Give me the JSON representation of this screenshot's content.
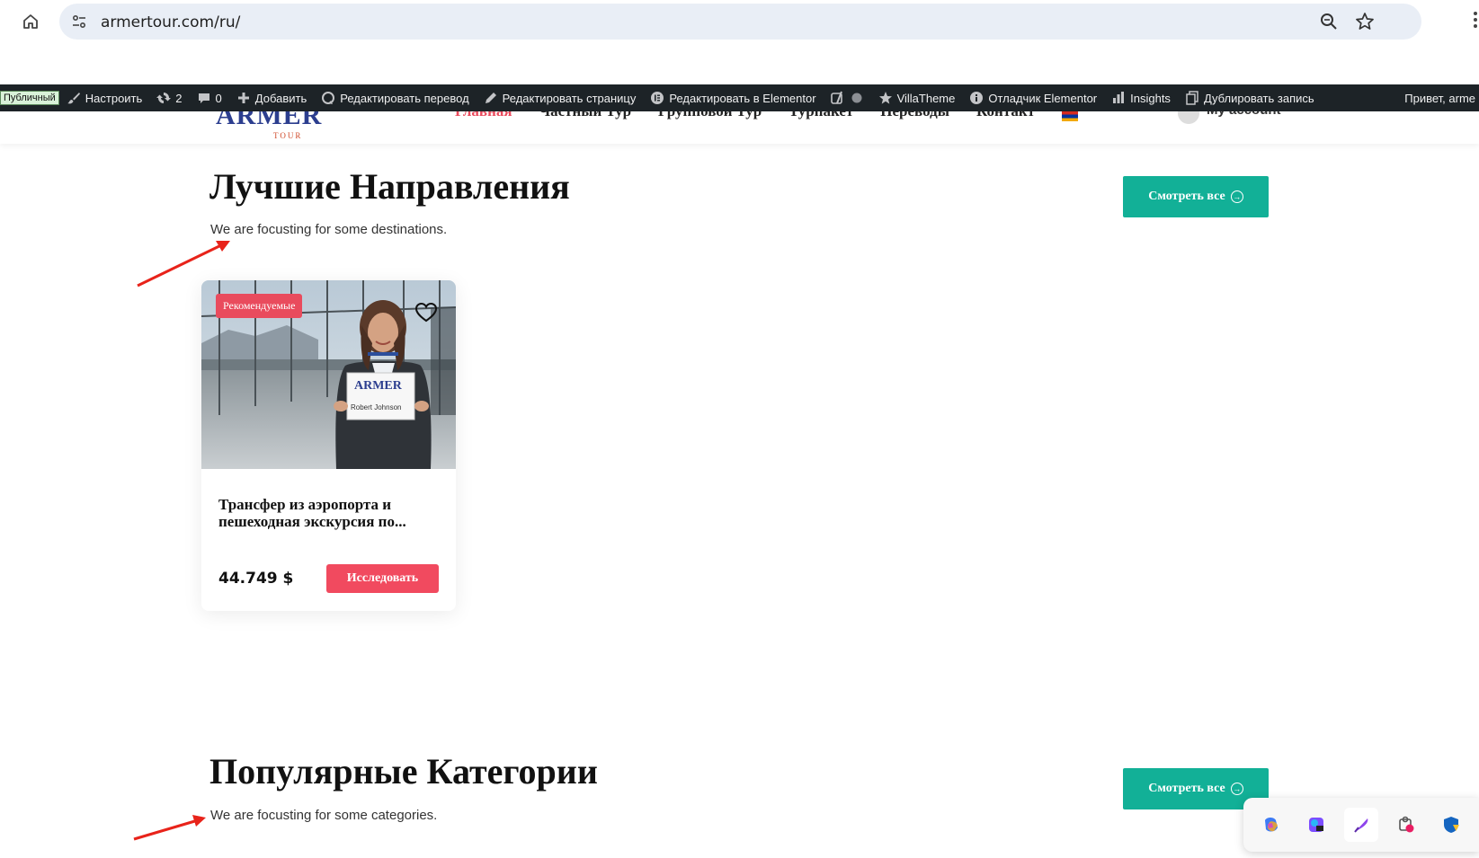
{
  "browser": {
    "url": "armertour.com/ru/"
  },
  "admin_bar": {
    "public_badge": "Публичный",
    "customize": "Настроить",
    "updates_count": "2",
    "comments_count": "0",
    "add_new": "Добавить",
    "edit_translation": "Редактировать перевод",
    "edit_page": "Редактировать страницу",
    "edit_elementor": "Редактировать в Elementor",
    "villatheme": "VillaTheme",
    "elementor_debugger": "Отладчик Elementor",
    "insights": "Insights",
    "duplicate": "Дублировать запись",
    "greeting": "Привет, arme"
  },
  "header": {
    "logo_text": "ARMER",
    "logo_sub": "TOUR",
    "nav": [
      "Главная",
      "Частный Тур",
      "Групповой Тур",
      "Турпакет",
      "Переводы",
      "Контакт"
    ],
    "account": "My account"
  },
  "destinations": {
    "title": "Лучшие Направления",
    "subtitle": "We are focusting for some destinations.",
    "see_all": "Смотреть все"
  },
  "card": {
    "badge": "Рекомендуемые",
    "sign_brand": "ARMER",
    "sign_name": "Robert Johnson",
    "title": "Трансфер из аэропорта и пешеходная экскурсия по...",
    "price": "44.749 $",
    "button": "Исследовать"
  },
  "categories": {
    "title": "Популярные Категории",
    "subtitle": "We are focusting for some categories.",
    "see_all": "Смотреть все"
  },
  "colors": {
    "teal": "#12b097",
    "red": "#f14a5f",
    "admin_bar": "#1d2327"
  }
}
